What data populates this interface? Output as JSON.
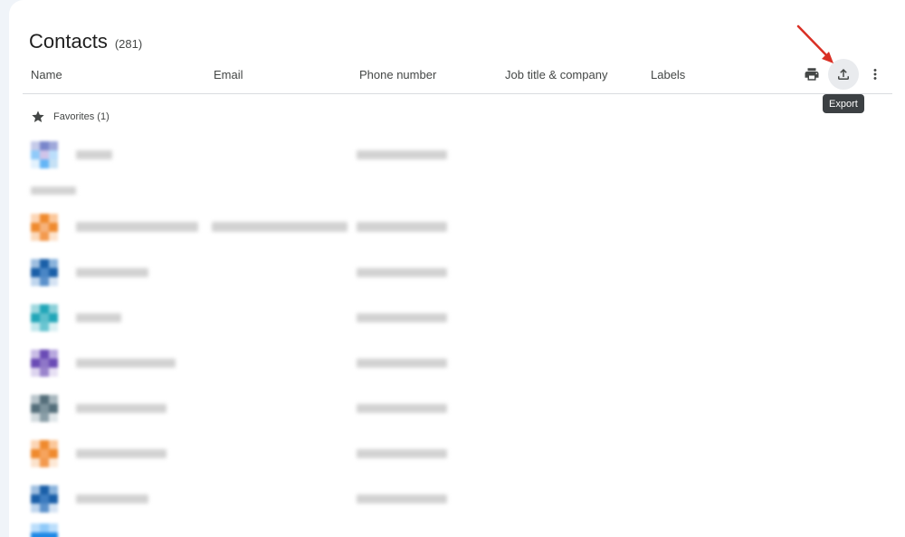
{
  "header": {
    "title": "Contacts",
    "count": "(281)"
  },
  "columns": {
    "name": "Name",
    "email": "Email",
    "phone": "Phone number",
    "job": "Job title & company",
    "labels": "Labels"
  },
  "toolbar": {
    "print_icon": "print-icon",
    "export_icon": "upload-icon",
    "more_icon": "more-vert-icon",
    "tooltip": "Export"
  },
  "favorites": {
    "label": "Favorites (1)"
  },
  "colors": {
    "accent_arrow": "#d93025",
    "row_avatars": [
      "#7986cb",
      "#ef8a2e",
      "#1a5fa8",
      "#21a6b8",
      "#6a4bb5",
      "#546e7a",
      "#ef8a2e",
      "#1a5fa8",
      "#1e88e5"
    ]
  }
}
